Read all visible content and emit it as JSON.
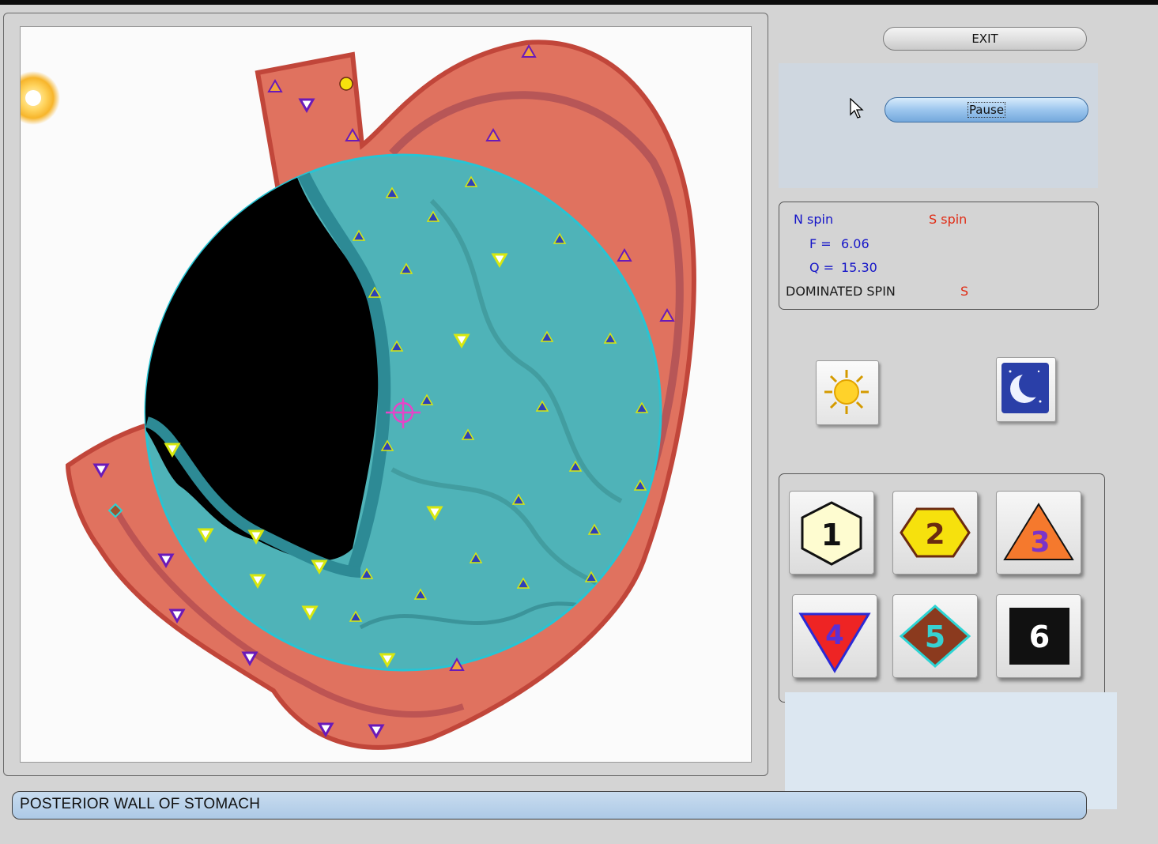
{
  "toolbar": {
    "exit_label": "EXIT",
    "pause_label": "Pause"
  },
  "spin": {
    "n_label": "N spin",
    "s_label": "S spin",
    "f_label": "F =",
    "f_value": "6.06",
    "q_label": "Q =",
    "q_value": "15.30",
    "dominated_label": "DOMINATED SPIN",
    "dominated_value": "S"
  },
  "modes": [
    {
      "name": "day-mode",
      "icon": "sun-icon"
    },
    {
      "name": "night-mode",
      "icon": "moon-icon"
    }
  ],
  "levels": [
    {
      "label": "1",
      "shape": "hexagon",
      "fill": "#fefcd0",
      "text_color": "#111111"
    },
    {
      "label": "2",
      "shape": "hexagon",
      "fill": "#f6e10d",
      "text_color": "#6b2a10"
    },
    {
      "label": "3",
      "shape": "triangle-up",
      "fill": "#f5792d",
      "text_color": "#7b33c8"
    },
    {
      "label": "4",
      "shape": "triangle-down",
      "fill": "#ee2424",
      "text_color": "#5a2fd6"
    },
    {
      "label": "5",
      "shape": "diamond",
      "fill": "#8b3a1e",
      "text_color": "#37d1d1"
    },
    {
      "label": "6",
      "shape": "square",
      "fill": "#111111",
      "text_color": "#ffffff"
    }
  ],
  "status": {
    "organ_name": "POSTERIOR WALL OF STOMACH"
  },
  "colors": {
    "tissue": "#e0725f",
    "lens": "#4fb3b8",
    "cursor": "#e645c8",
    "marker_blue": "#2e3fb8",
    "marker_yellow": "#d8e80f",
    "marker_purple": "#6a1ab8"
  }
}
